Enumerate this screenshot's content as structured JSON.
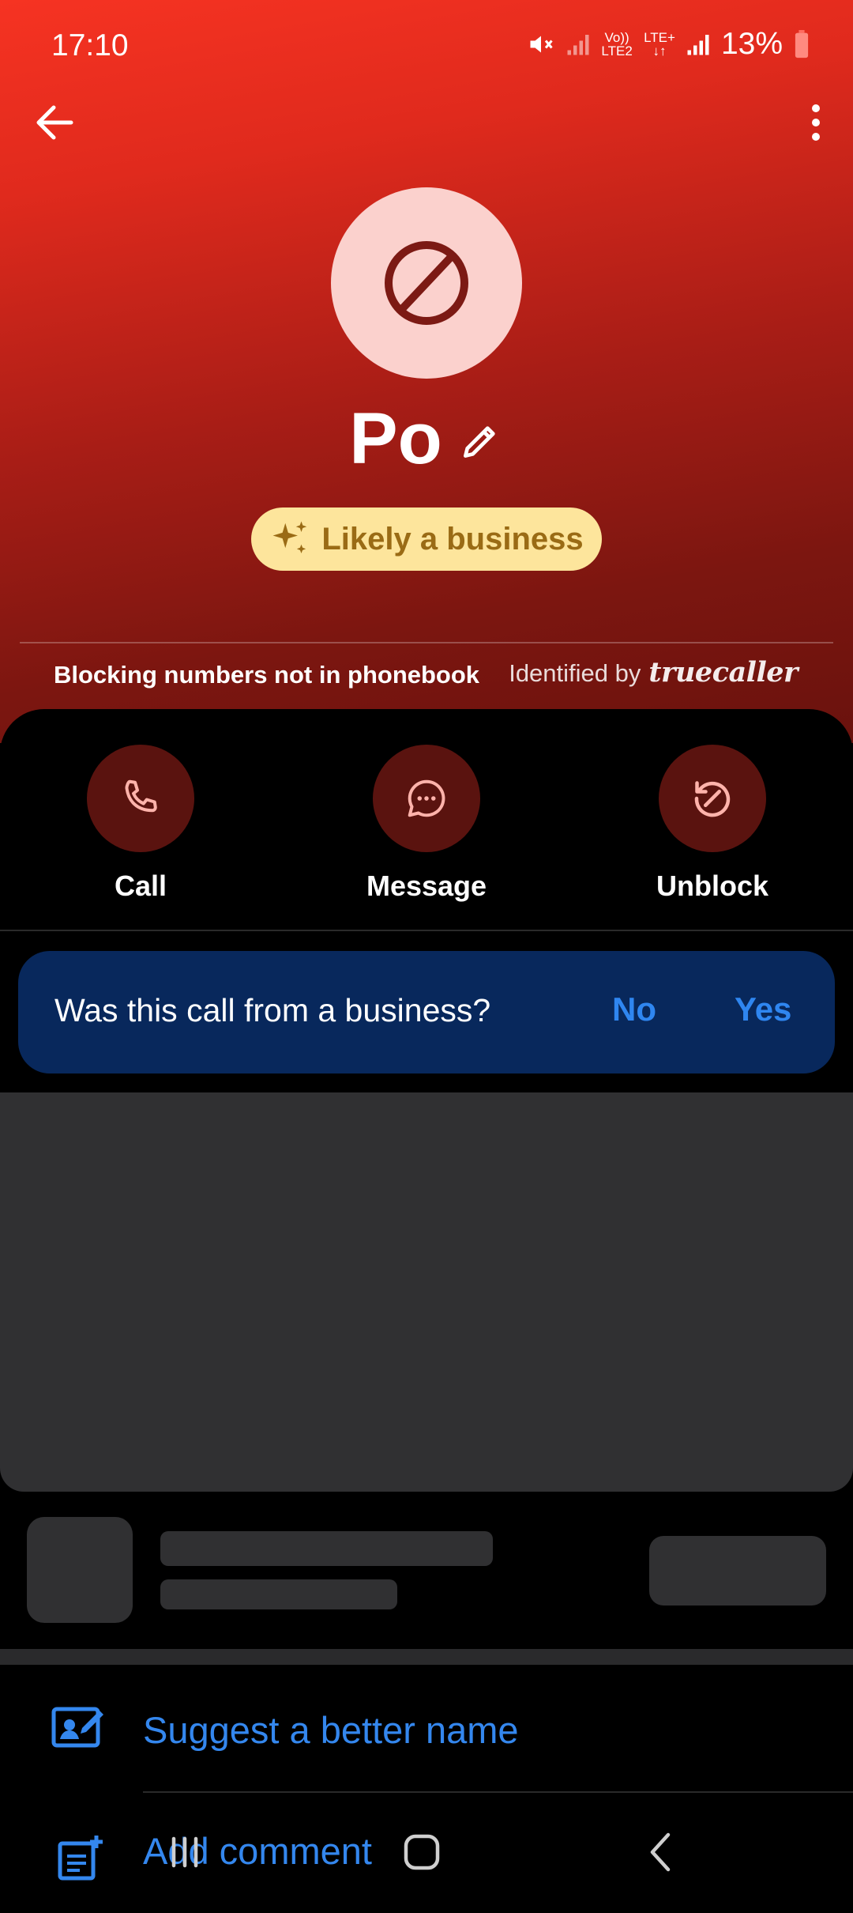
{
  "status_bar": {
    "time": "17:10",
    "network_lte": "LTE+",
    "network_volte": "Vo)) LTE2",
    "battery_percent": "13%",
    "battery_level": 0.13,
    "icons": [
      "mute-icon",
      "signal-icon",
      "volte-icon",
      "lte-plus-icon",
      "signal-icon",
      "battery-icon"
    ]
  },
  "header": {
    "back_icon": "arrow-left-icon",
    "menu_icon": "more-vertical-icon"
  },
  "contact": {
    "avatar_icon": "blocked-icon",
    "name": "Po",
    "edit_icon": "pencil-icon",
    "badge_label": "Likely a business",
    "badge_icon": "sparkles-icon"
  },
  "info_bar": {
    "blocking_note": "Blocking numbers not in phonebook",
    "identified_by": "Identified by",
    "brand": "truecaller"
  },
  "actions": [
    {
      "label": "Call",
      "icon": "phone-icon"
    },
    {
      "label": "Message",
      "icon": "message-icon"
    },
    {
      "label": "Unblock",
      "icon": "unblock-icon"
    }
  ],
  "business_prompt": {
    "question": "Was this call from a business?",
    "no_label": "No",
    "yes_label": "Yes"
  },
  "list_items": [
    {
      "label": "Suggest a better name",
      "icon": "edit-name-icon"
    },
    {
      "label": "Add comment",
      "icon": "add-note-icon"
    }
  ],
  "nav_bar": {
    "recents_icon": "recents-icon",
    "home_icon": "home-icon",
    "back_icon": "back-chevron-icon"
  },
  "colors": {
    "hero_top": "#f63322",
    "hero_bottom": "#6a120d",
    "badge_bg": "#fde59c",
    "badge_text": "#9a6b15",
    "action_circle": "#5a130f",
    "prompt_bg": "#08285c",
    "link_blue": "#3487ee"
  }
}
